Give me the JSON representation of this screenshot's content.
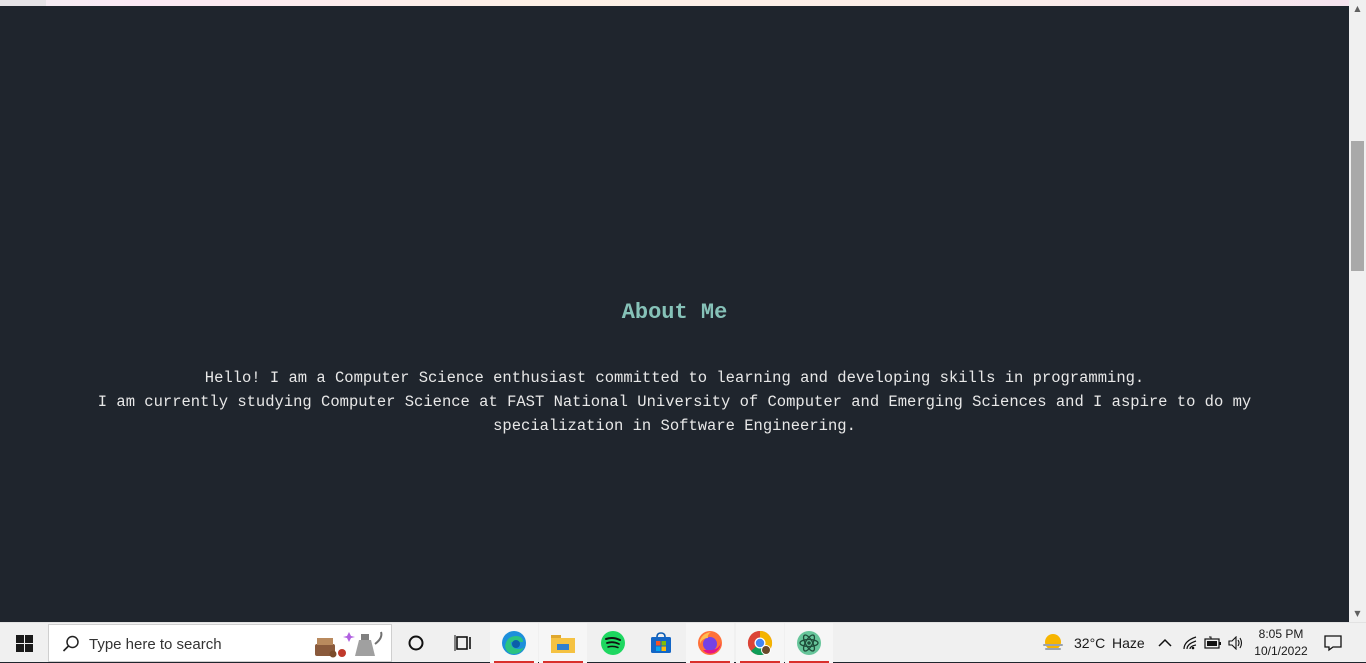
{
  "about": {
    "title": "About Me",
    "line1": "Hello! I am a Computer Science enthusiast committed to learning and developing skills in programming.",
    "line2": "I am currently studying Computer Science at FAST National University of Computer and Emerging Sciences and I aspire to do my specialization in Software Engineering."
  },
  "taskbar": {
    "search_placeholder": "Type here to search",
    "apps": [
      "cortana-icon",
      "task-view-icon",
      "edge-icon",
      "file-explorer-icon",
      "spotify-icon",
      "store-icon",
      "firefox-icon",
      "chrome-icon",
      "atom-icon"
    ],
    "weather": {
      "temp": "32°C",
      "condition": "Haze"
    },
    "clock": {
      "time": "8:05 PM",
      "date": "10/1/2022"
    }
  },
  "colors": {
    "page_bg": "#1f252d",
    "title": "#86c2b8",
    "text": "#e8e8e8",
    "taskbar_bg": "#f0f0f0",
    "active_indicator": "#d9302c"
  }
}
